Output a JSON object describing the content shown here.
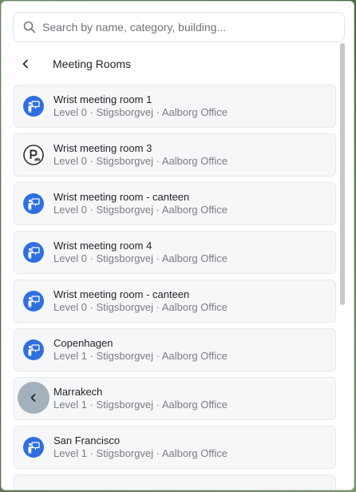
{
  "search": {
    "placeholder": "Search by name, category, building..."
  },
  "header": {
    "title": "Meeting Rooms"
  },
  "rooms": [
    {
      "name": "Wrist meeting room 1",
      "location": "Level 0 · Stigsborgvej · Aalborg Office",
      "icon": "meeting-room-icon"
    },
    {
      "name": "Wrist meeting room 3",
      "location": "Level 0 · Stigsborgvej · Aalborg Office",
      "icon": "parking-icon"
    },
    {
      "name": "Wrist meeting room - canteen",
      "location": "Level 0 · Stigsborgvej · Aalborg Office",
      "icon": "meeting-room-icon"
    },
    {
      "name": "Wrist meeting room 4",
      "location": "Level 0 · Stigsborgvej · Aalborg Office",
      "icon": "meeting-room-icon"
    },
    {
      "name": "Wrist meeting room - canteen",
      "location": "Level 0 · Stigsborgvej · Aalborg Office",
      "icon": "meeting-room-icon"
    },
    {
      "name": "Copenhagen",
      "location": "Level 1 · Stigsborgvej · Aalborg Office",
      "icon": "meeting-room-icon"
    },
    {
      "name": "Marrakech",
      "location": "Level 1 · Stigsborgvej · Aalborg Office",
      "icon": "meeting-room-icon"
    },
    {
      "name": "San Francisco",
      "location": "Level 1 · Stigsborgvej · Aalborg Office",
      "icon": "meeting-room-icon"
    }
  ],
  "colors": {
    "accent": "#2f6fe0",
    "float_button": "#a3b1bd"
  }
}
